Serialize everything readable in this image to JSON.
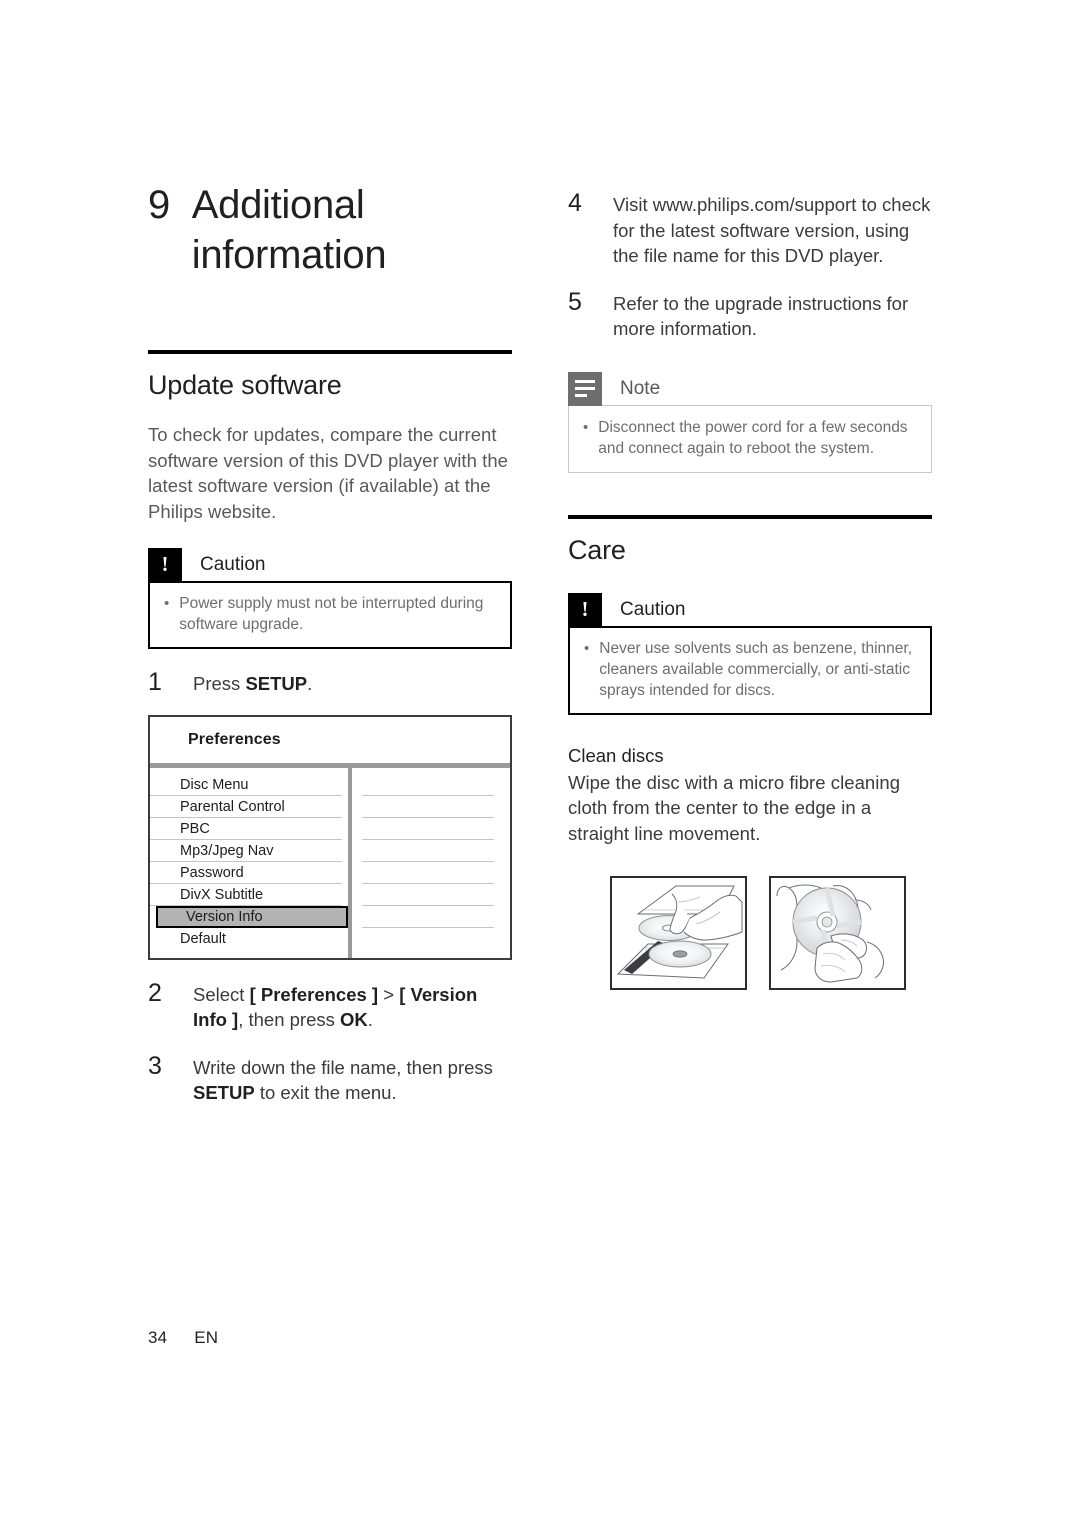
{
  "chapter": {
    "number": "9",
    "title_line1": "Additional",
    "title_line2": "information"
  },
  "left_column": {
    "section_heading": "Update software",
    "intro_paragraph": "To check for updates, compare the current software version of this DVD player with the latest software version (if available) at the Philips website.",
    "caution": {
      "label": "Caution",
      "icon": "exclamation-icon",
      "bullet": "Power supply must not be interrupted during software upgrade."
    },
    "steps": [
      {
        "num": "1",
        "text_html": "Press <b>SETUP</b>."
      },
      {
        "num": "2",
        "text_html": "Select <b>[ Preferences ]</b> &gt; <b>[ Version Info ]</b>, then press <b>OK</b>."
      },
      {
        "num": "3",
        "text_html": "Write down the file name, then press <b>SETUP</b> to exit the menu."
      }
    ],
    "preferences_menu": {
      "title": "Preferences",
      "items": [
        {
          "label": "Disc Menu",
          "selected": false
        },
        {
          "label": "Parental Control",
          "selected": false
        },
        {
          "label": "PBC",
          "selected": false
        },
        {
          "label": "Mp3/Jpeg Nav",
          "selected": false
        },
        {
          "label": "Password",
          "selected": false
        },
        {
          "label": "DivX Subtitle",
          "selected": false
        },
        {
          "label": "Version Info",
          "selected": true
        },
        {
          "label": "Default",
          "selected": false
        }
      ]
    }
  },
  "right_column": {
    "steps": [
      {
        "num": "4",
        "text_html": "Visit www.philips.com/support to check for the latest software version, using the file name for this DVD player."
      },
      {
        "num": "5",
        "text_html": "Refer to the upgrade instructions for more information."
      }
    ],
    "note": {
      "label": "Note",
      "icon": "note-lines-icon",
      "bullet": "Disconnect the power cord for a few seconds and connect again to reboot the system."
    },
    "section_heading": "Care",
    "caution": {
      "label": "Caution",
      "icon": "exclamation-icon",
      "bullet": "Never use solvents such as benzene, thinner, cleaners available commercially, or anti-static sprays intended for discs."
    },
    "clean_discs": {
      "heading": "Clean discs",
      "paragraph": "Wipe the disc with a micro fibre cleaning cloth from the center to the edge in a straight line movement."
    },
    "figures": [
      {
        "name": "disc-tray-removal-illustration"
      },
      {
        "name": "disc-wipe-illustration"
      }
    ]
  },
  "footer": {
    "page_number": "34",
    "language": "EN"
  },
  "colors": {
    "text": "#231f20",
    "muted": "#6d6e71",
    "rule": "#000000",
    "note_icon": "#6e6e6e",
    "menu_highlight": "#b3b3b3"
  }
}
